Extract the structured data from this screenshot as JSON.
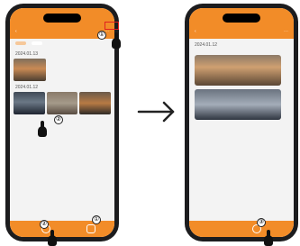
{
  "colors": {
    "accent": "#f28c28",
    "phone_frame": "#1c1c1e",
    "highlight_box": "#e02020"
  },
  "left_screen": {
    "tabs": [
      {
        "label": "",
        "active": true
      },
      {
        "label": "",
        "active": false
      }
    ],
    "dates": [
      "2024.01.13",
      "2024.01.12"
    ],
    "callouts": {
      "top": "①",
      "bottom_left": "②",
      "bottom_right": "①",
      "middle": "②"
    }
  },
  "arrow": {
    "label": "→"
  },
  "right_screen": {
    "date": "2024.01.12",
    "callouts": {
      "bottom": "③"
    }
  }
}
